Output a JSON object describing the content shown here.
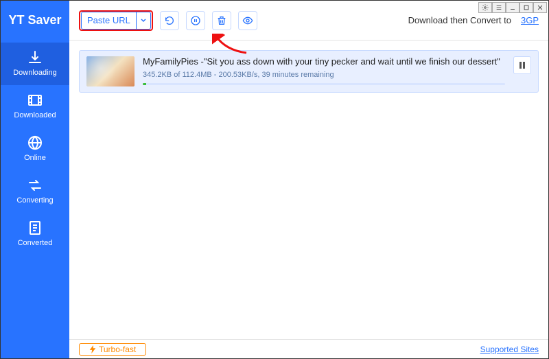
{
  "app": {
    "title": "YT Saver"
  },
  "sidebar": {
    "items": [
      {
        "label": "Downloading"
      },
      {
        "label": "Downloaded"
      },
      {
        "label": "Online"
      },
      {
        "label": "Converting"
      },
      {
        "label": "Converted"
      }
    ]
  },
  "toolbar": {
    "paste_label": "Paste URL",
    "convert_text": "Download then Convert to",
    "convert_format": "3GP"
  },
  "downloads": [
    {
      "title": "MyFamilyPies -\"Sit you ass down with your tiny pecker and wait until we finish our dessert\"",
      "status": "345.2KB of 112.4MB - 200.53KB/s, 39 minutes remaining"
    }
  ],
  "footer": {
    "turbo": "Turbo-fast",
    "supported": "Supported Sites"
  }
}
